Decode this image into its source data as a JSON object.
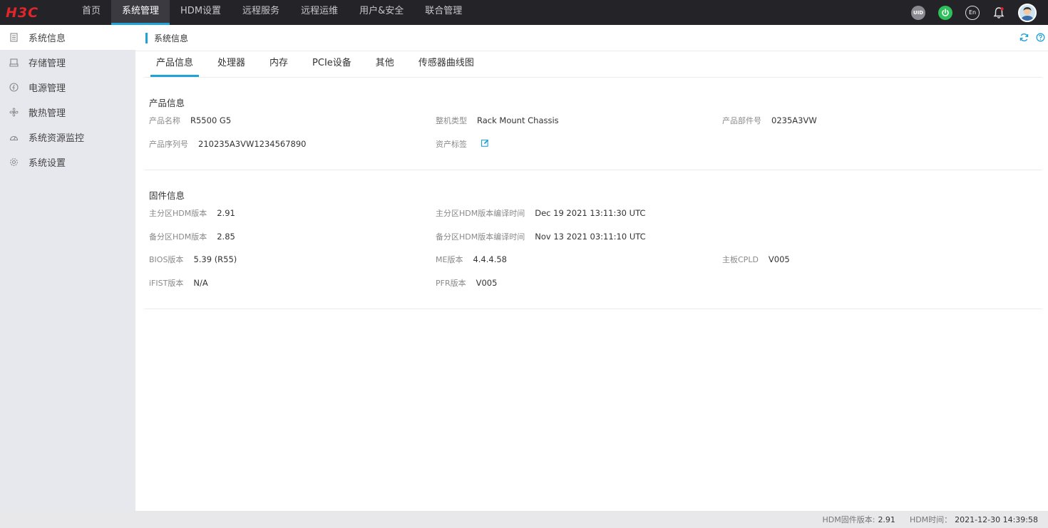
{
  "brand": {
    "logo_text": "H3C"
  },
  "nav": {
    "items": [
      {
        "label": "首页",
        "active": false
      },
      {
        "label": "系统管理",
        "active": true
      },
      {
        "label": "HDM设置",
        "active": false
      },
      {
        "label": "远程服务",
        "active": false
      },
      {
        "label": "远程运维",
        "active": false
      },
      {
        "label": "用户&安全",
        "active": false
      },
      {
        "label": "联合管理",
        "active": false
      }
    ]
  },
  "top_icons": {
    "uid_label": "UID",
    "lang_label": "En"
  },
  "sidebar": {
    "items": [
      {
        "label": "系统信息",
        "icon": "document-icon",
        "active": true
      },
      {
        "label": "存储管理",
        "icon": "storage-icon",
        "active": false
      },
      {
        "label": "电源管理",
        "icon": "power-icon",
        "active": false
      },
      {
        "label": "散热管理",
        "icon": "fan-icon",
        "active": false
      },
      {
        "label": "系统资源监控",
        "icon": "gauge-icon",
        "active": false
      },
      {
        "label": "系统设置",
        "icon": "gear-icon",
        "active": false
      }
    ]
  },
  "page": {
    "title": "系统信息"
  },
  "tabs": [
    {
      "label": "产品信息",
      "active": true
    },
    {
      "label": "处理器",
      "active": false
    },
    {
      "label": "内存",
      "active": false
    },
    {
      "label": "PCIe设备",
      "active": false
    },
    {
      "label": "其他",
      "active": false
    },
    {
      "label": "传感器曲线图",
      "active": false
    }
  ],
  "product": {
    "title": "产品信息",
    "name_label": "产品名称",
    "name_value": "R5500 G5",
    "chassis_label": "整机类型",
    "chassis_value": "Rack Mount Chassis",
    "part_label": "产品部件号",
    "part_value": "0235A3VW",
    "serial_label": "产品序列号",
    "serial_value": "210235A3VW1234567890",
    "asset_label": "资产标签"
  },
  "firmware": {
    "title": "固件信息",
    "main_hdm_label": "主分区HDM版本",
    "main_hdm_value": "2.91",
    "main_build_label": "主分区HDM版本编译时间",
    "main_build_value": "Dec 19 2021 13:11:30 UTC",
    "backup_hdm_label": "备分区HDM版本",
    "backup_hdm_value": "2.85",
    "backup_build_label": "备分区HDM版本编译时间",
    "backup_build_value": "Nov 13 2021 03:11:10 UTC",
    "bios_label": "BIOS版本",
    "bios_value": "5.39 (R55)",
    "me_label": "ME版本",
    "me_value": "4.4.4.58",
    "cpld_label": "主板CPLD",
    "cpld_value": "V005",
    "ifist_label": "iFIST版本",
    "ifist_value": "N/A",
    "pfr_label": "PFR版本",
    "pfr_value": "V005"
  },
  "footer": {
    "fw_label": "HDM固件版本:",
    "fw_value": "2.91",
    "time_label": "HDM时间：",
    "time_value": "2021-12-30 14:39:58"
  },
  "colors": {
    "accent": "#1ea2d8",
    "topbar": "#242428",
    "brand_red": "#e0262b",
    "power_green": "#2fbf5b"
  }
}
